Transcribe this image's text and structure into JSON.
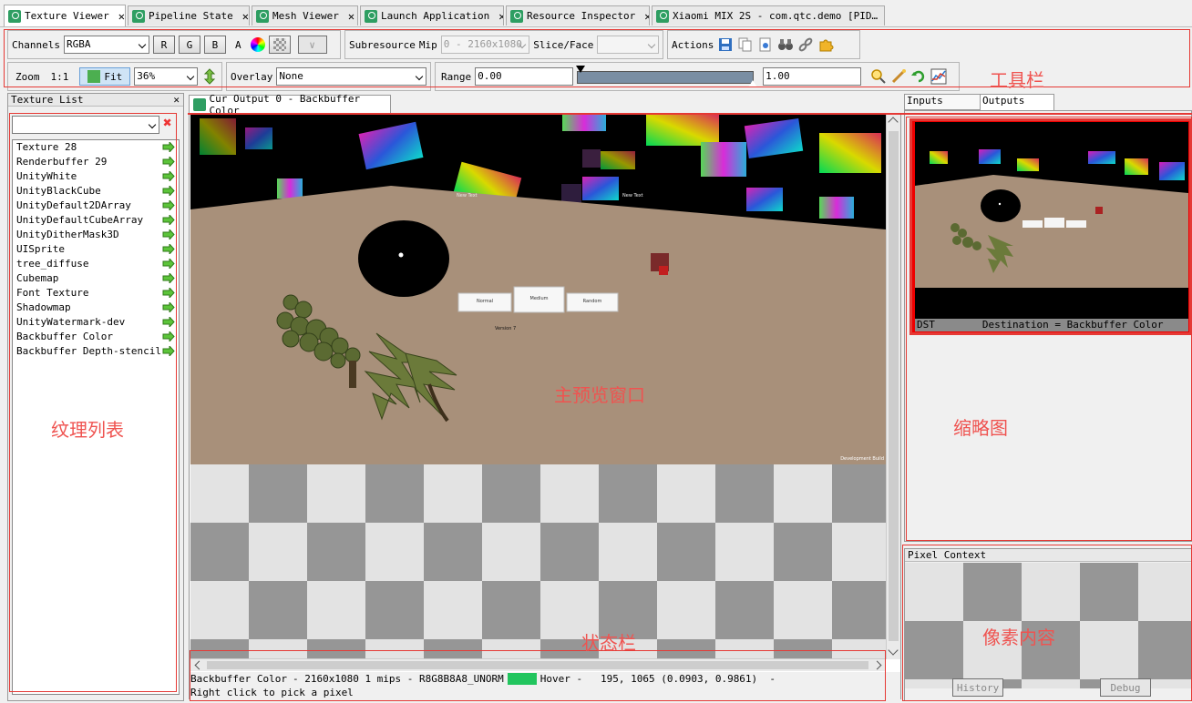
{
  "tabs": [
    {
      "label": "Texture Viewer",
      "active": true
    },
    {
      "label": "Pipeline State"
    },
    {
      "label": "Mesh Viewer"
    },
    {
      "label": "Launch Application"
    },
    {
      "label": "Resource Inspector"
    },
    {
      "label": "Xiaomi MIX 2S - com.qtc.demo [PID…"
    }
  ],
  "toolbar": {
    "channels_label": "Channels",
    "channels_value": "RGBA",
    "r": "R",
    "g": "G",
    "b": "B",
    "a": "A",
    "subresource_label": "Subresource",
    "mip_label": "Mip",
    "mip_value": "0 - 2160x1080",
    "slice_label": "Slice/Face",
    "slice_value": "",
    "actions_label": "Actions",
    "zoom_label": "Zoom",
    "zoom_1to1": "1:1",
    "fit_label": "Fit",
    "zoom_value": "36%",
    "overlay_label": "Overlay",
    "overlay_value": "None",
    "range_label": "Range",
    "range_min": "0.00",
    "range_max": "1.00"
  },
  "texture_list": {
    "title": "Texture List",
    "items": [
      "Texture 28",
      "Renderbuffer 29",
      "UnityWhite",
      "UnityBlackCube",
      "UnityDefault2DArray",
      "UnityDefaultCubeArray",
      "UnityDitherMask3D",
      "UISprite",
      "tree_diffuse",
      "Cubemap",
      "Font Texture",
      "Shadowmap",
      "UnityWatermark-dev",
      "Backbuffer Color",
      "Backbuffer Depth-stencil"
    ]
  },
  "main_view": {
    "tab_label": "Cur Output 0 - Backbuffer Color",
    "scene_btn_left": "Normal",
    "scene_btn_mid": "Medium",
    "scene_btn_right": "Random",
    "scene_version": "Version 7",
    "scene_label_left": "New Text",
    "scene_label_right": "New Text",
    "scene_watermark": "Development Build"
  },
  "status": {
    "line1_name": "Backbuffer Color",
    "line1_info": "- 2160x1080 1 mips - R8G8B8A8_UNORM",
    "swatch_color": "#22c55e",
    "hover": "Hover -   195, 1065 (0.0903, 0.9861)  -",
    "line2": "Right click to pick a pixel"
  },
  "right_panel": {
    "tab_inputs": "Inputs",
    "tab_outputs": "Outputs",
    "thumb_dst": "DST",
    "thumb_desc": "Destination = Backbuffer Color",
    "pixel_context_title": "Pixel Context",
    "history_btn": "History",
    "debug_btn": "Debug"
  },
  "annotations": {
    "toolbar": "工具栏",
    "texture_list": "纹理列表",
    "main_preview": "主预览窗口",
    "thumbnail": "缩略图",
    "status_bar": "状态栏",
    "pixel_content": "像素内容"
  }
}
